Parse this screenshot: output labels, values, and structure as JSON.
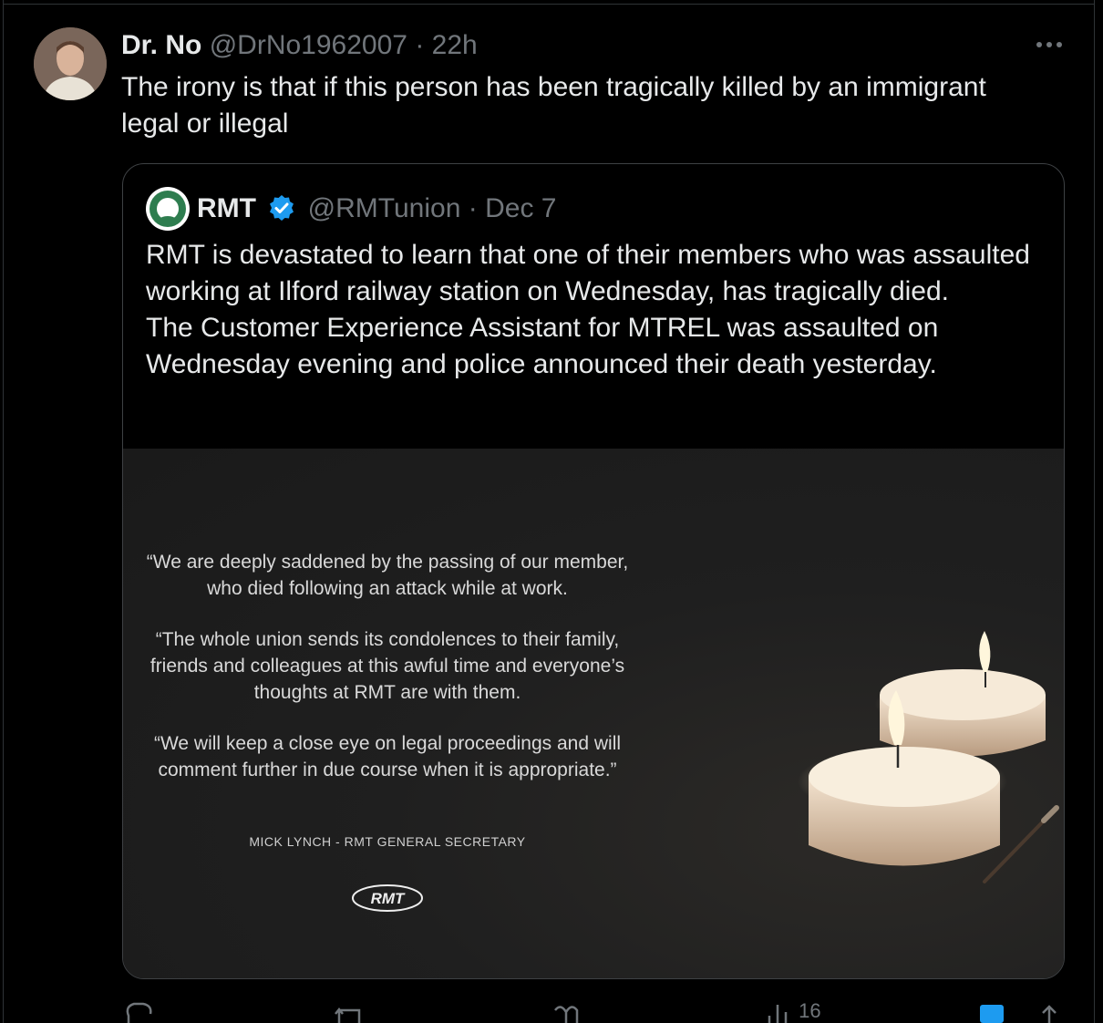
{
  "tweet": {
    "author_name": "Dr. No",
    "handle": "@DrNo1962007",
    "separator": "·",
    "time": "22h",
    "text": "The irony is that if this person has been tragically killed by an immigrant legal or illegal",
    "more_icon": "more-icon"
  },
  "quote": {
    "name": "RMT",
    "handle": "@RMTunion",
    "separator": "·",
    "date": "Dec 7",
    "verified": true,
    "text": "RMT is devastated to learn that one of their members who was assaulted working at Ilford railway station on Wednesday, has tragically died.\nThe Customer Experience Assistant for MTREL was assaulted on Wednesday evening and police announced their death yesterday.",
    "media": {
      "quote1": "“We are deeply saddened by the passing of our member, who died following an attack while at work.",
      "quote2": "“The whole union sends its condolences to their family, friends and colleagues at this awful time and everyone’s thoughts at RMT are with them.",
      "quote3": "“We will keep a close eye on legal proceedings and will comment further in due course when it is appropriate.”",
      "signature": "MICK LYNCH - RMT GENERAL SECRETARY",
      "logo_text": "RMT"
    }
  },
  "actions": {
    "reply_icon": "reply-icon",
    "retweet_icon": "retweet-icon",
    "like_icon": "like-icon",
    "views_icon": "views-icon",
    "views_count": "16",
    "bookmark_icon": "bookmark-icon",
    "share_icon": "share-icon"
  },
  "colors": {
    "background": "#000000",
    "text": "#e7e9ea",
    "secondary": "#71767b",
    "verified": "#1d9bf0",
    "bookmark": "#1d9bf0"
  }
}
